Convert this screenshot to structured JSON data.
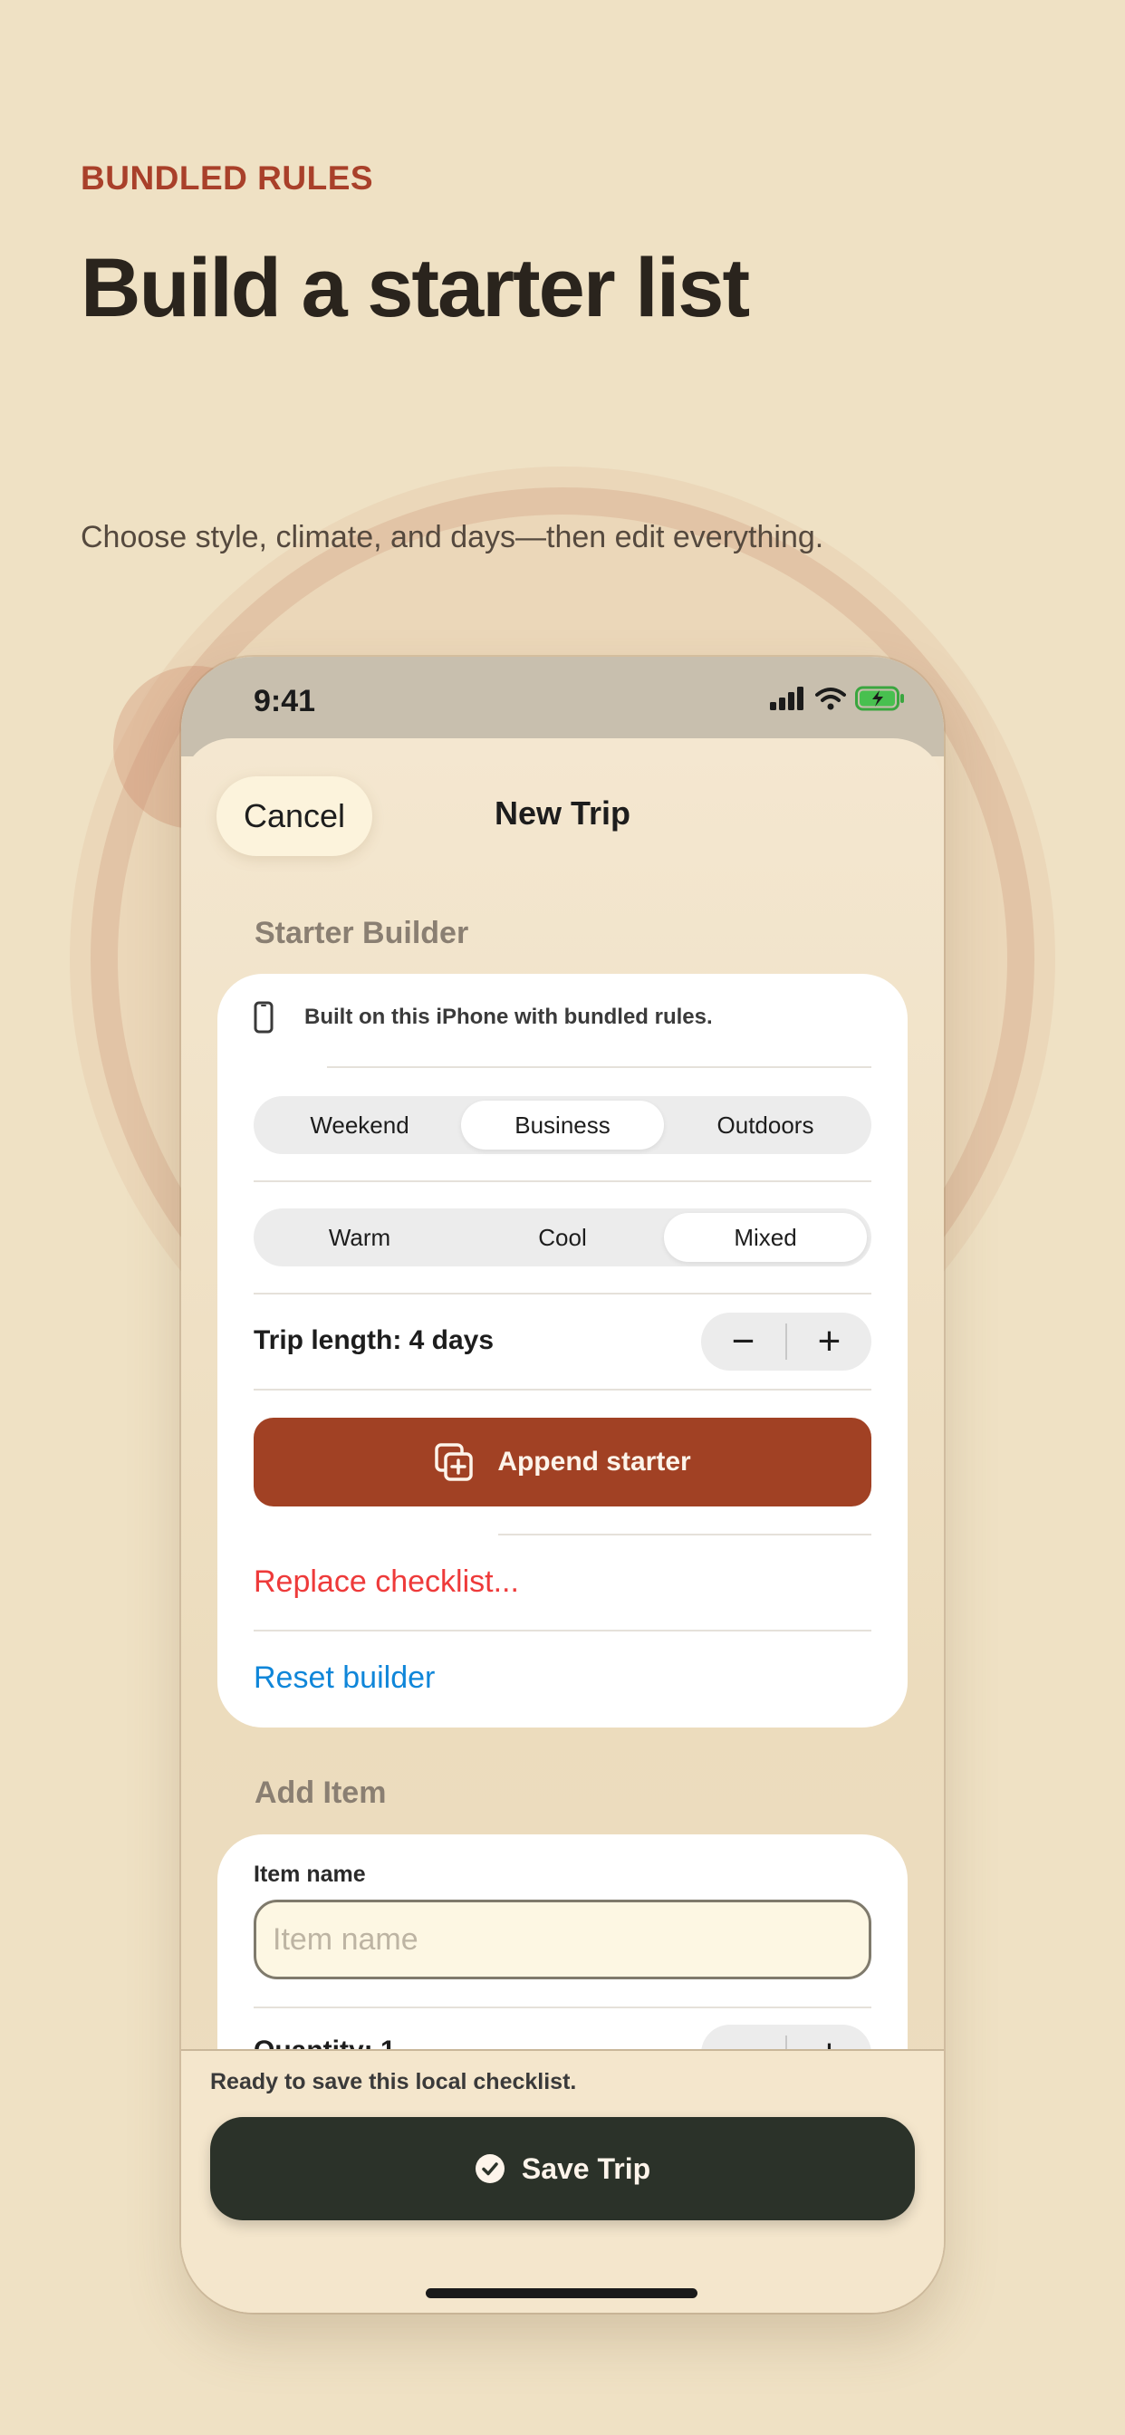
{
  "page": {
    "eyebrow": "BUNDLED RULES",
    "headline": "Build a starter list",
    "subhead": "Choose style, climate, and days—then edit everything."
  },
  "status_bar": {
    "time": "9:41"
  },
  "nav": {
    "cancel_label": "Cancel",
    "title": "New Trip"
  },
  "starter_builder": {
    "section_label": "Starter Builder",
    "info_text": "Built on this iPhone with bundled rules.",
    "styles": [
      "Weekend",
      "Business",
      "Outdoors"
    ],
    "selected_style": "Business",
    "climates": [
      "Warm",
      "Cool",
      "Mixed"
    ],
    "selected_climate": "Mixed",
    "trip_length_label": "Trip length: 4 days",
    "decrement_symbol": "−",
    "increment_symbol": "+",
    "append_label": "Append starter",
    "replace_label": "Replace checklist...",
    "reset_label": "Reset builder"
  },
  "add_item": {
    "section_label": "Add Item",
    "item_name_label": "Item name",
    "item_name_placeholder": "Item name",
    "item_name_value": "",
    "quantity_label": "Quantity: 1"
  },
  "bottom": {
    "ready_text": "Ready to save this local checklist.",
    "save_label": "Save Trip"
  },
  "colors": {
    "background": "#efe1c4",
    "accent": "#a9402a",
    "append_button": "#a14124",
    "save_button": "#2b3229",
    "destructive": "#ee3a3a",
    "link": "#0f86d9"
  },
  "icons": [
    "signal-icon",
    "wifi-icon",
    "battery-charging-icon",
    "iphone-icon",
    "append-copy-icon",
    "checkmark-circle-icon"
  ]
}
